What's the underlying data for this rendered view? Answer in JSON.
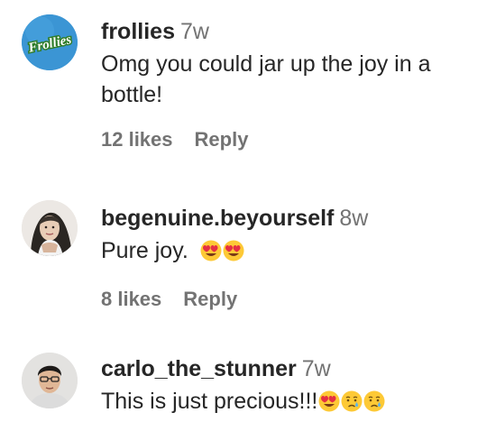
{
  "comments": [
    {
      "username": "frollies",
      "time": "7w",
      "text": "Omg you could jar up the joy in a bottle!",
      "likes": "12 likes",
      "reply": "Reply",
      "avatar": {
        "type": "brand-logo",
        "logo_text": "Frollies",
        "bg": "#3e97d3"
      }
    },
    {
      "username": "begenuine.beyourself",
      "time": "8w",
      "text": "Pure joy.",
      "emojis": [
        "heart-eyes-emoji",
        "heart-eyes-emoji"
      ],
      "likes": "8 likes",
      "reply": "Reply",
      "avatar": {
        "type": "photo",
        "icon": "woman-portrait"
      }
    },
    {
      "username": "carlo_the_stunner",
      "time": "7w",
      "text": "This is just precious!!!",
      "emojis": [
        "heart-eyes-emoji",
        "crying-face-emoji",
        "crying-face-emoji"
      ],
      "avatar": {
        "type": "photo",
        "icon": "man-portrait"
      }
    }
  ],
  "colors": {
    "username": "#262626",
    "secondary": "#737373",
    "emoji_face": "#fdc936",
    "emoji_heart": "#e52f43",
    "emoji_tear": "#5cb4f0"
  }
}
